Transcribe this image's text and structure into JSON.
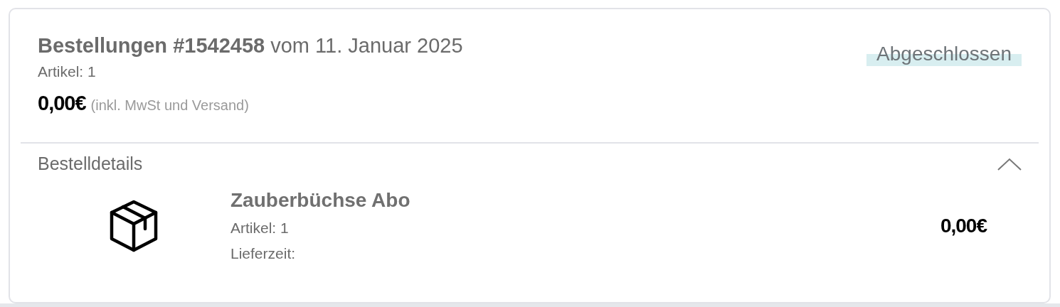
{
  "order": {
    "title": "**Bestellungen #1542458** vom 11. Januar 2025",
    "items_count": "Artikel: 1",
    "total": "0,00€",
    "total_note": "(inkl. MwSt und Versand)",
    "status": "Abgeschlossen"
  },
  "details": {
    "label": "Bestelldetails",
    "expanded": true,
    "items": [
      {
        "name": "Zauberbüchse Abo",
        "quantity": "Artikel: 1",
        "delivery": "Lieferzeit:",
        "price": "0,00€"
      }
    ]
  }
}
